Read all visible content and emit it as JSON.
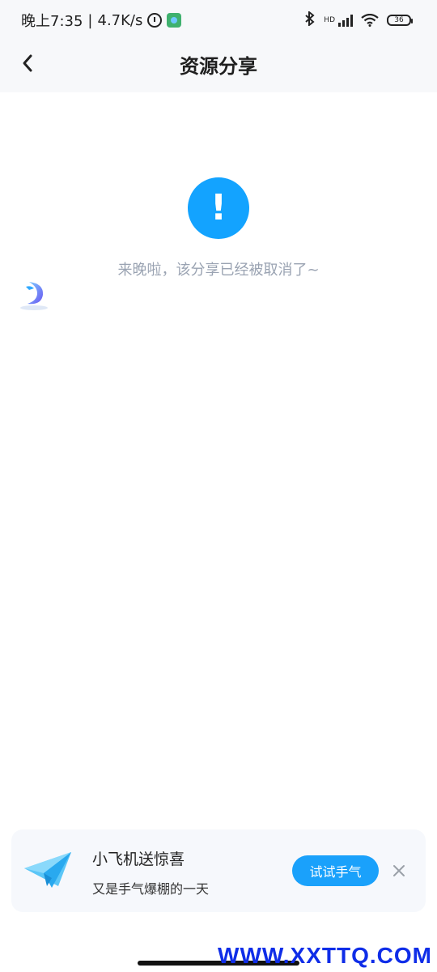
{
  "status_bar": {
    "time": "晚上7:35",
    "separator": "|",
    "network_speed": "4.7K/s",
    "hd_label": "HD",
    "battery_level": "36"
  },
  "nav": {
    "title": "资源分享"
  },
  "main": {
    "alert_symbol": "!",
    "message": "来晚啦，该分享已经被取消了~"
  },
  "promo": {
    "title": "小飞机送惊喜",
    "subtitle": "又是手气爆棚的一天",
    "button_label": "试试手气"
  },
  "watermark": "WWW.XXTTQ.COM",
  "colors": {
    "accent": "#13a3ff",
    "button": "#1aa1fb",
    "message_text": "#9aa3b2",
    "watermark": "#0f2de8"
  }
}
